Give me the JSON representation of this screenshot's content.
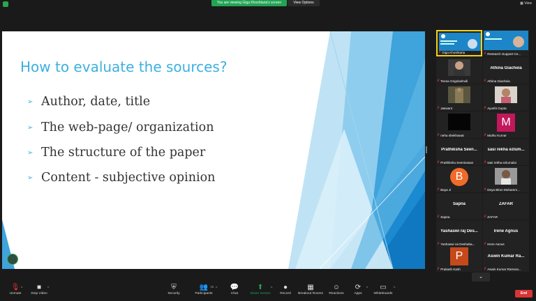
{
  "top_bar": {
    "banner_text": "You are viewing Giga Khoshtaria's screen",
    "view_options": "View Options",
    "view_button": "View"
  },
  "slide": {
    "title": "How to evaluate the sources?",
    "bullets": [
      "Author, date, title",
      "The web-page/ organization",
      "The structure of the paper",
      "Content - subjective opinion"
    ]
  },
  "participants": [
    {
      "name": "Giga Khoshtaria"
    },
    {
      "name": "Research Support Ce..."
    },
    {
      "name": "Teona Grigolashvili"
    },
    {
      "name": "Athina Giacheia",
      "display": "Athina Giacheia"
    },
    {
      "name": "Jaswant"
    },
    {
      "name": "Ayushi Gupta"
    },
    {
      "name": "neha shekhawat"
    },
    {
      "name": "Muthu Kumar",
      "avatar": "M",
      "color": "#c2185b"
    },
    {
      "name": "Prathiksha Seenivasan",
      "display": "Prathiksha Seen..."
    },
    {
      "name": "sasi rekha ezlumalai",
      "display": "sasi rekha ezlum..."
    },
    {
      "name": "Baya Ji",
      "avatar": "B",
      "color": "#f06a2a"
    },
    {
      "name": "Deya Biton Mohamm..."
    },
    {
      "name": "Sapna",
      "display": "Sapna"
    },
    {
      "name": "ZAFAR",
      "display": "ZAFAR"
    },
    {
      "name": "Yashaswi raj Deshaba...",
      "display": "Yashaswi raj Des..."
    },
    {
      "name": "Irene Agnus",
      "display": "Irene Agnus"
    },
    {
      "name": "Prakash Kash",
      "avatar": "P",
      "color": "#c6491b"
    },
    {
      "name": "Aswin Kumar Ramara...",
      "display": "Aswin Kumar Ra..."
    }
  ],
  "toolbar": {
    "unmute": "Unmute",
    "stop_video": "Stop Video",
    "security": "Security",
    "participants": "Participants",
    "participants_count": "25",
    "chat": "Chat",
    "share_screen": "Share Screen",
    "record": "Record",
    "breakout_rooms": "Breakout Rooms",
    "reactions": "Reactions",
    "apps": "Apps",
    "whiteboards": "Whiteboards",
    "end": "End"
  },
  "colors": {
    "accent_green": "#23a455",
    "slide_title": "#3bb0e0",
    "end_red": "#d83535"
  }
}
